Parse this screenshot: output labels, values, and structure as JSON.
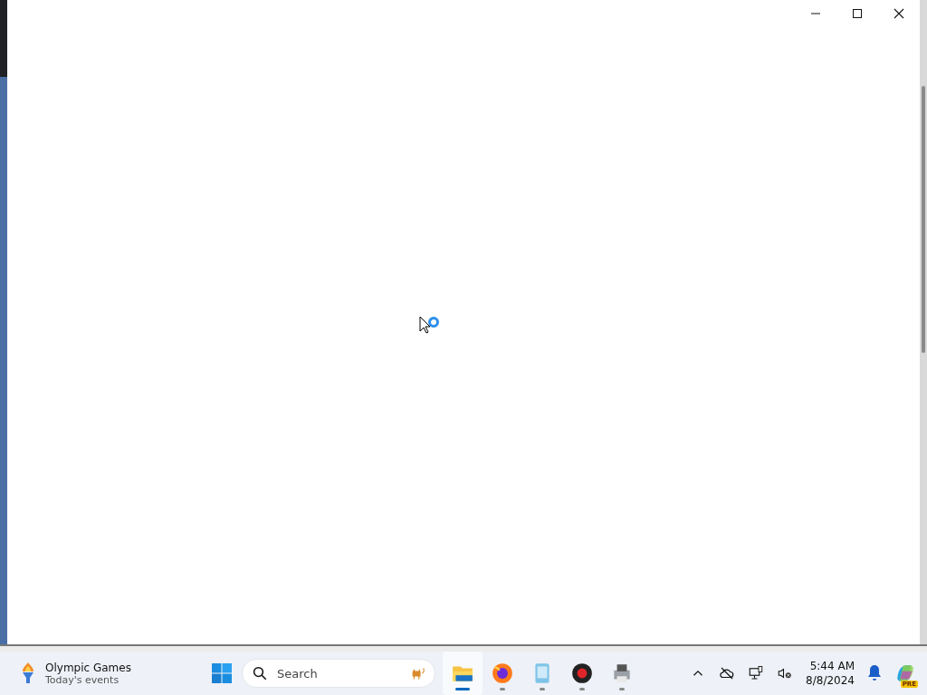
{
  "window": {
    "controls": [
      {
        "kind": "minimize"
      },
      {
        "kind": "maximize"
      },
      {
        "kind": "close"
      }
    ],
    "busy": true
  },
  "taskbar": {
    "widget": {
      "title": "Olympic Games",
      "subtitle": "Today's events"
    },
    "search": {
      "placeholder": "Search"
    },
    "apps": [
      {
        "kind": "files",
        "running": true,
        "selected": true
      },
      {
        "kind": "browser",
        "running": true,
        "selected": false
      },
      {
        "kind": "notepad",
        "running": true,
        "selected": false
      },
      {
        "kind": "record",
        "running": true,
        "selected": false
      },
      {
        "kind": "printer",
        "running": true,
        "selected": false
      }
    ],
    "tray": [
      {
        "kind": "chevron"
      },
      {
        "kind": "cloud-off"
      },
      {
        "kind": "network"
      },
      {
        "kind": "sound-off"
      }
    ],
    "clock": {
      "time": "5:44 AM",
      "date": "8/8/2024"
    },
    "notifications": true,
    "copilot_badge": "PRE"
  }
}
